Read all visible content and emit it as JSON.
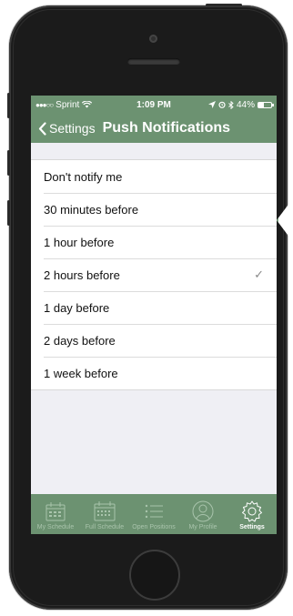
{
  "status_bar": {
    "carrier": "Sprint",
    "time": "1:09 PM",
    "battery": "44%",
    "battery_level": 0.44
  },
  "nav": {
    "back_label": "Settings",
    "title": "Push Notifications"
  },
  "options": [
    {
      "label": "Don't notify me",
      "selected": false
    },
    {
      "label": "30 minutes before",
      "selected": false
    },
    {
      "label": "1 hour before",
      "selected": false
    },
    {
      "label": "2 hours before",
      "selected": true
    },
    {
      "label": "1 day before",
      "selected": false
    },
    {
      "label": "2 days before",
      "selected": false
    },
    {
      "label": "1 week before",
      "selected": false
    }
  ],
  "tabs": [
    {
      "label": "My Schedule",
      "icon": "calendar-icon",
      "active": false
    },
    {
      "label": "Full Schedule",
      "icon": "calendar-grid-icon",
      "active": false
    },
    {
      "label": "Open Positions",
      "icon": "list-icon",
      "active": false
    },
    {
      "label": "My Profile",
      "icon": "person-icon",
      "active": false
    },
    {
      "label": "Settings",
      "icon": "gear-icon",
      "active": true
    }
  ],
  "colors": {
    "accent": "#6c9271",
    "tab_inactive": "#a9c4ac"
  }
}
